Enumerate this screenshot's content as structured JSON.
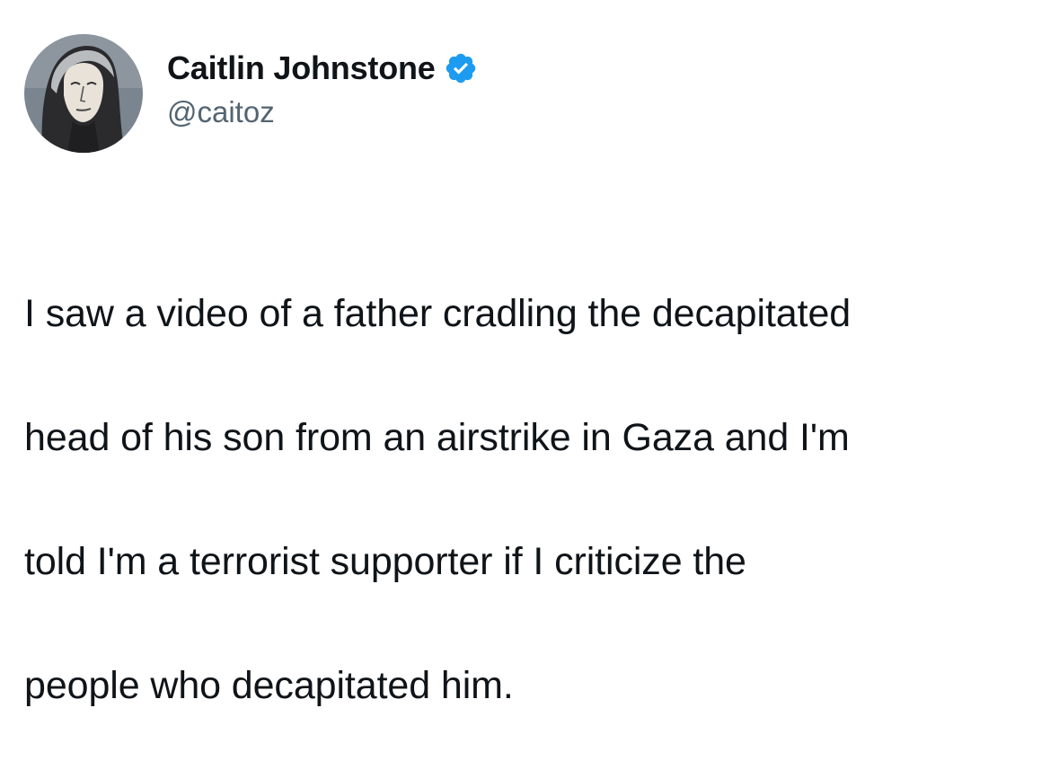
{
  "author": {
    "display_name": "Caitlin Johnstone",
    "handle": "@caitoz",
    "verified": true,
    "verified_icon": "verified-badge-icon",
    "verified_color": "#1d9bf0"
  },
  "tweet": {
    "text_lines": [
      "I saw a video of a father cradling the decapitated",
      "head of his son from an airstrike in Gaza and I'm",
      "told I'm a terrorist supporter if I criticize the",
      "people who decapitated him."
    ]
  },
  "colors": {
    "text": "#0f1419",
    "secondary_text": "#536471",
    "background": "#ffffff"
  }
}
